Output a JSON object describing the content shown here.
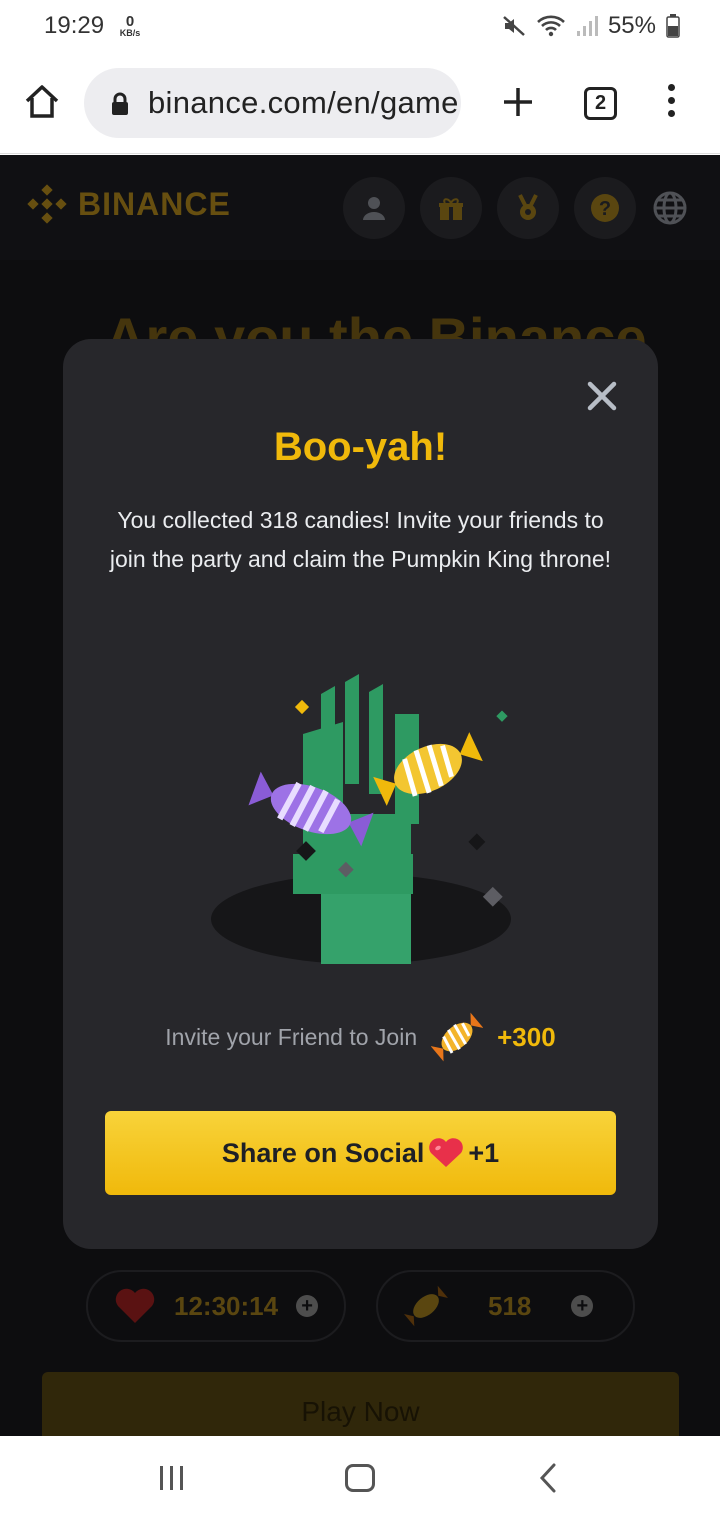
{
  "status_bar": {
    "time": "19:29",
    "net_speed_value": "0",
    "net_speed_unit": "KB/s",
    "battery": "55%"
  },
  "browser": {
    "url": "binance.com/en/game",
    "tab_count": "2"
  },
  "site": {
    "logo": "BINANCE",
    "header_icons": [
      "user-icon",
      "gift-icon",
      "medal-icon",
      "help-icon",
      "globe-icon"
    ],
    "background_title": "Are you the Binance",
    "timer": "12:30:14",
    "candies_count": "518",
    "play_button": "Play Now"
  },
  "modal": {
    "title": "Boo-yah!",
    "message": "You collected 318 candies! Invite your friends to join the party and claim the Pumpkin King throne!",
    "invite_text": "Invite your Friend to Join",
    "invite_bonus": "+300",
    "share_button_label": "Share on Social",
    "share_button_bonus": "+1"
  },
  "colors": {
    "accent": "#f0b90b",
    "background": "#151518",
    "modal": "#27272b"
  }
}
